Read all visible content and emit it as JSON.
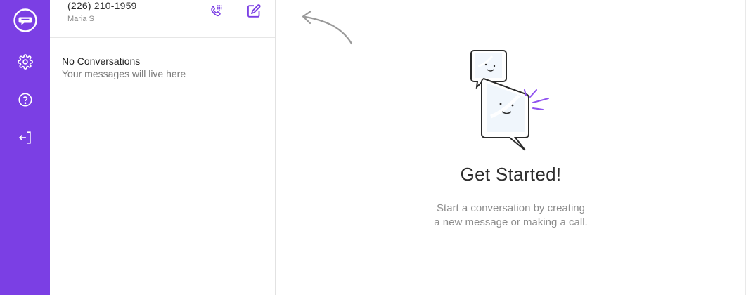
{
  "rail": {
    "background": "#7b3fe4",
    "items": [
      {
        "name": "chat-logo-icon"
      },
      {
        "name": "gear-icon"
      },
      {
        "name": "help-icon"
      },
      {
        "name": "logout-icon"
      }
    ]
  },
  "account": {
    "number": "(226) 210-1959",
    "name": "Maria S",
    "actions": [
      "dialpad-icon",
      "compose-icon"
    ]
  },
  "conversations": {
    "empty_title": "No Conversations",
    "empty_subtitle": "Your messages will live here"
  },
  "main": {
    "title": "Get Started!",
    "subtitle_line1": "Start a conversation by creating",
    "subtitle_line2": "a new message or making a call."
  },
  "colors": {
    "accent": "#7b3fe4",
    "text_dark": "#2c2c2c",
    "text_muted": "#8c8c8c"
  }
}
